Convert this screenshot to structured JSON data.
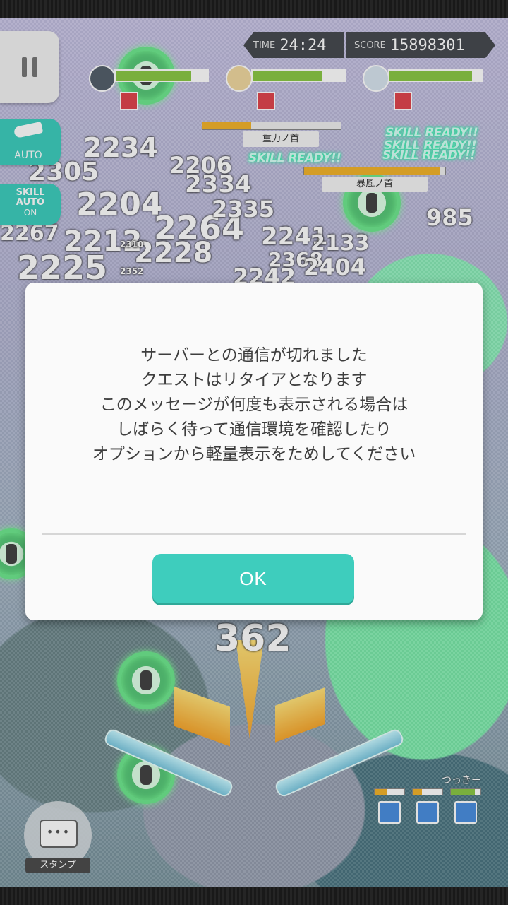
{
  "hud": {
    "time_label": "TIME",
    "time_value": "24:24",
    "score_label": "SCORE",
    "score_value": "15898301"
  },
  "side": {
    "auto_label": "AUTO",
    "skill_line1": "SKILL",
    "skill_line2": "AUTO",
    "skill_line3": "ON"
  },
  "party": [
    {
      "hp": 0.82
    },
    {
      "hp": 0.76
    },
    {
      "hp": 0.9
    }
  ],
  "enemies": [
    {
      "name": "重力ノ首",
      "gauge": 0.35
    },
    {
      "name": "暴風ノ首",
      "gauge": 0.96
    }
  ],
  "skill_ready": [
    "SKILL READY!!",
    "SKILL READY!!",
    "SKILL READY!!",
    "SKILL READY!!"
  ],
  "damage_numbers": [
    "2234",
    "2305",
    "2204",
    "2264",
    "2241",
    "2212",
    "2228",
    "2225",
    "2334",
    "2335",
    "2368",
    "2267",
    "985",
    "362",
    "2242",
    "2404",
    "2133",
    "2206",
    "2310",
    "2352"
  ],
  "dialog": {
    "lines": [
      "サーバーとの通信が切れました",
      "クエストはリタイアとなります",
      "このメッセージが何度も表示される場合は",
      "しばらく待って通信環境を確認したり",
      "オプションから軽量表示をためしてください"
    ],
    "ok_label": "OK"
  },
  "stamp": {
    "label": "スタンプ"
  },
  "player_name": "つっきー",
  "colors": {
    "accent": "#3ecdbd",
    "hp_fill": "#8ac846",
    "skill_icon": "#e0464e",
    "enemy_gauge": "#f2b32c"
  }
}
